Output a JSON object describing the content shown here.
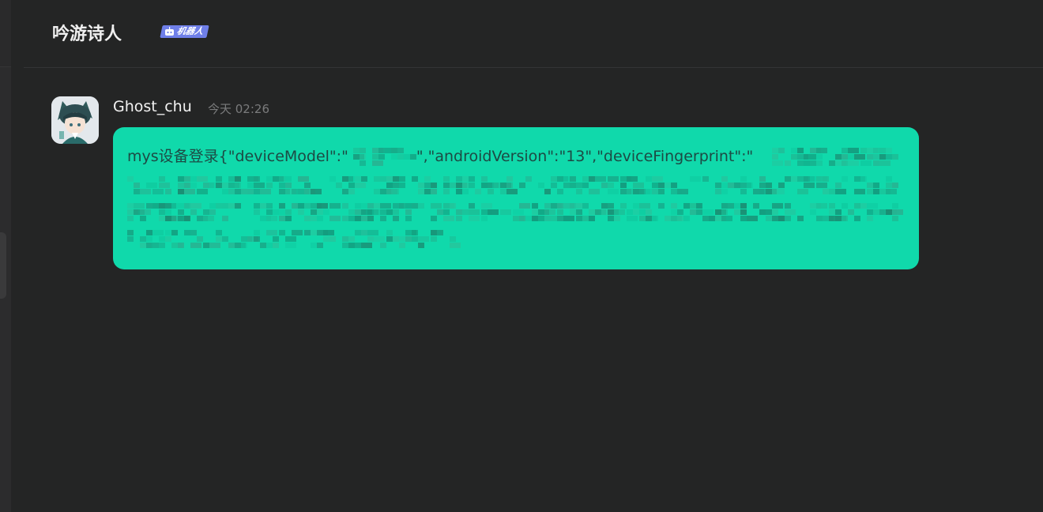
{
  "channel": {
    "title": "吟游诗人",
    "badge_label": "机器人",
    "badge_icon": "robot-icon",
    "badge_color": "#6f7fe8"
  },
  "message": {
    "author": "Ghost_chu",
    "timestamp": "今天 02:26",
    "text": "mys设备登录{\"deviceModel\":\"",
    "text_part2": "\",\"androidVersion\":\"13\",\"deviceFingerprint\":\"",
    "redaction_note": "pixelated content",
    "bubble_color": "#10d9ab"
  }
}
